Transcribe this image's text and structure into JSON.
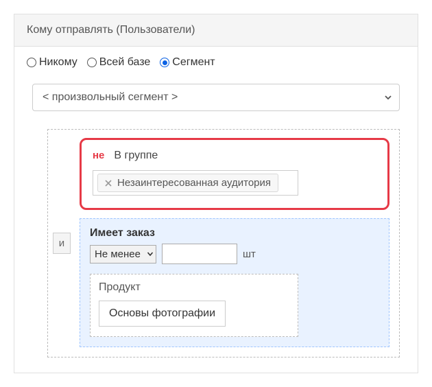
{
  "header": {
    "title": "Кому отправлять (Пользователи)"
  },
  "radios": {
    "none_label": "Никому",
    "all_label": "Всей базе",
    "segment_label": "Сегмент",
    "selected": "segment"
  },
  "segment_select": {
    "selected_label": "< произвольный сегмент >"
  },
  "logic": {
    "and_label": "и"
  },
  "rule_group": {
    "negation_label": "не",
    "title": "В группе",
    "tag_value": "Незаинтересованная аудитория"
  },
  "rule_order": {
    "title": "Имеет заказ",
    "comparator_label": "Не менее",
    "qty_value": "",
    "unit_label": "шт",
    "product_section_label": "Продукт",
    "product_value": "Основы фотографии"
  }
}
